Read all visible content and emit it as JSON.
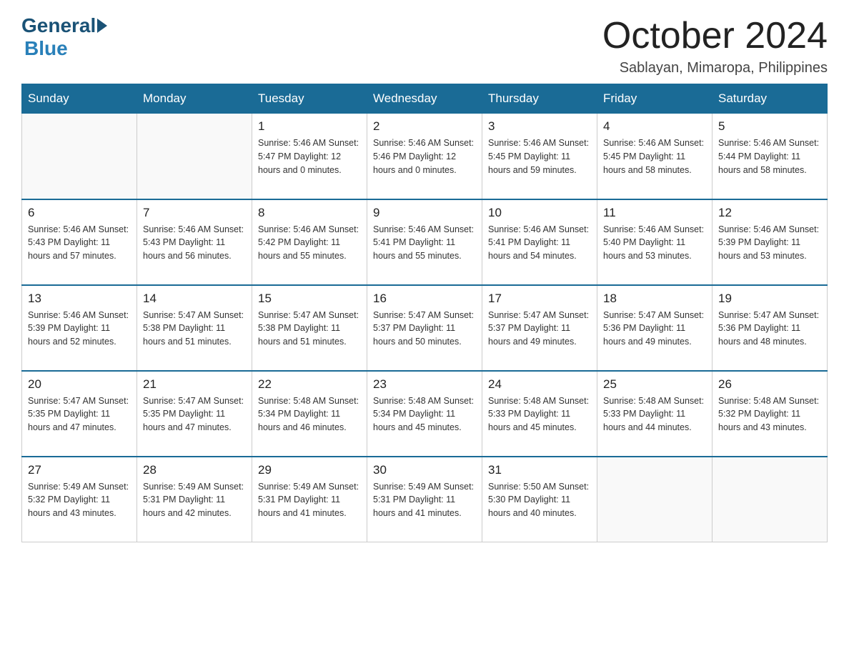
{
  "header": {
    "logo_general": "General",
    "logo_blue": "Blue",
    "title": "October 2024",
    "subtitle": "Sablayan, Mimaropa, Philippines"
  },
  "days_of_week": [
    "Sunday",
    "Monday",
    "Tuesday",
    "Wednesday",
    "Thursday",
    "Friday",
    "Saturday"
  ],
  "weeks": [
    [
      {
        "day": "",
        "info": ""
      },
      {
        "day": "",
        "info": ""
      },
      {
        "day": "1",
        "info": "Sunrise: 5:46 AM\nSunset: 5:47 PM\nDaylight: 12 hours\nand 0 minutes."
      },
      {
        "day": "2",
        "info": "Sunrise: 5:46 AM\nSunset: 5:46 PM\nDaylight: 12 hours\nand 0 minutes."
      },
      {
        "day": "3",
        "info": "Sunrise: 5:46 AM\nSunset: 5:45 PM\nDaylight: 11 hours\nand 59 minutes."
      },
      {
        "day": "4",
        "info": "Sunrise: 5:46 AM\nSunset: 5:45 PM\nDaylight: 11 hours\nand 58 minutes."
      },
      {
        "day": "5",
        "info": "Sunrise: 5:46 AM\nSunset: 5:44 PM\nDaylight: 11 hours\nand 58 minutes."
      }
    ],
    [
      {
        "day": "6",
        "info": "Sunrise: 5:46 AM\nSunset: 5:43 PM\nDaylight: 11 hours\nand 57 minutes."
      },
      {
        "day": "7",
        "info": "Sunrise: 5:46 AM\nSunset: 5:43 PM\nDaylight: 11 hours\nand 56 minutes."
      },
      {
        "day": "8",
        "info": "Sunrise: 5:46 AM\nSunset: 5:42 PM\nDaylight: 11 hours\nand 55 minutes."
      },
      {
        "day": "9",
        "info": "Sunrise: 5:46 AM\nSunset: 5:41 PM\nDaylight: 11 hours\nand 55 minutes."
      },
      {
        "day": "10",
        "info": "Sunrise: 5:46 AM\nSunset: 5:41 PM\nDaylight: 11 hours\nand 54 minutes."
      },
      {
        "day": "11",
        "info": "Sunrise: 5:46 AM\nSunset: 5:40 PM\nDaylight: 11 hours\nand 53 minutes."
      },
      {
        "day": "12",
        "info": "Sunrise: 5:46 AM\nSunset: 5:39 PM\nDaylight: 11 hours\nand 53 minutes."
      }
    ],
    [
      {
        "day": "13",
        "info": "Sunrise: 5:46 AM\nSunset: 5:39 PM\nDaylight: 11 hours\nand 52 minutes."
      },
      {
        "day": "14",
        "info": "Sunrise: 5:47 AM\nSunset: 5:38 PM\nDaylight: 11 hours\nand 51 minutes."
      },
      {
        "day": "15",
        "info": "Sunrise: 5:47 AM\nSunset: 5:38 PM\nDaylight: 11 hours\nand 51 minutes."
      },
      {
        "day": "16",
        "info": "Sunrise: 5:47 AM\nSunset: 5:37 PM\nDaylight: 11 hours\nand 50 minutes."
      },
      {
        "day": "17",
        "info": "Sunrise: 5:47 AM\nSunset: 5:37 PM\nDaylight: 11 hours\nand 49 minutes."
      },
      {
        "day": "18",
        "info": "Sunrise: 5:47 AM\nSunset: 5:36 PM\nDaylight: 11 hours\nand 49 minutes."
      },
      {
        "day": "19",
        "info": "Sunrise: 5:47 AM\nSunset: 5:36 PM\nDaylight: 11 hours\nand 48 minutes."
      }
    ],
    [
      {
        "day": "20",
        "info": "Sunrise: 5:47 AM\nSunset: 5:35 PM\nDaylight: 11 hours\nand 47 minutes."
      },
      {
        "day": "21",
        "info": "Sunrise: 5:47 AM\nSunset: 5:35 PM\nDaylight: 11 hours\nand 47 minutes."
      },
      {
        "day": "22",
        "info": "Sunrise: 5:48 AM\nSunset: 5:34 PM\nDaylight: 11 hours\nand 46 minutes."
      },
      {
        "day": "23",
        "info": "Sunrise: 5:48 AM\nSunset: 5:34 PM\nDaylight: 11 hours\nand 45 minutes."
      },
      {
        "day": "24",
        "info": "Sunrise: 5:48 AM\nSunset: 5:33 PM\nDaylight: 11 hours\nand 45 minutes."
      },
      {
        "day": "25",
        "info": "Sunrise: 5:48 AM\nSunset: 5:33 PM\nDaylight: 11 hours\nand 44 minutes."
      },
      {
        "day": "26",
        "info": "Sunrise: 5:48 AM\nSunset: 5:32 PM\nDaylight: 11 hours\nand 43 minutes."
      }
    ],
    [
      {
        "day": "27",
        "info": "Sunrise: 5:49 AM\nSunset: 5:32 PM\nDaylight: 11 hours\nand 43 minutes."
      },
      {
        "day": "28",
        "info": "Sunrise: 5:49 AM\nSunset: 5:31 PM\nDaylight: 11 hours\nand 42 minutes."
      },
      {
        "day": "29",
        "info": "Sunrise: 5:49 AM\nSunset: 5:31 PM\nDaylight: 11 hours\nand 41 minutes."
      },
      {
        "day": "30",
        "info": "Sunrise: 5:49 AM\nSunset: 5:31 PM\nDaylight: 11 hours\nand 41 minutes."
      },
      {
        "day": "31",
        "info": "Sunrise: 5:50 AM\nSunset: 5:30 PM\nDaylight: 11 hours\nand 40 minutes."
      },
      {
        "day": "",
        "info": ""
      },
      {
        "day": "",
        "info": ""
      }
    ]
  ]
}
